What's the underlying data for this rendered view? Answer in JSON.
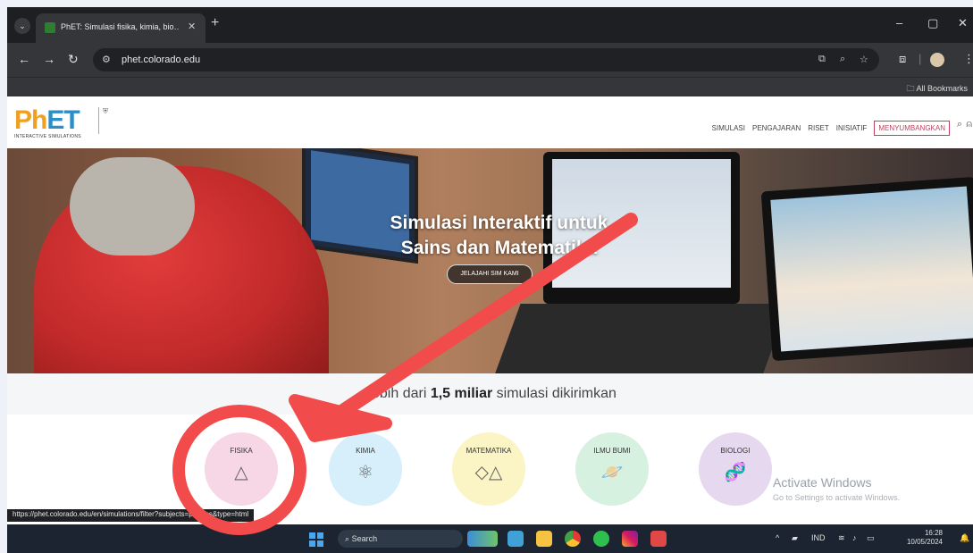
{
  "browser": {
    "tab_title": "PhET: Simulasi fisika, kimia, bio…",
    "tab_close": "✕",
    "new_tab": "+",
    "url": "phet.colorado.edu",
    "bookmarks_label": "All Bookmarks",
    "window_controls": [
      "–",
      "▢",
      "✕"
    ]
  },
  "site": {
    "logo_main_ph": "Ph",
    "logo_main_et": "ET",
    "logo_sub": "INTERACTIVE SIMULATIONS",
    "nav": [
      "SIMULASI",
      "PENGAJARAN",
      "RISET",
      "INISIATIF"
    ],
    "donate": "MENYUMBANGKAN"
  },
  "hero": {
    "title_line1": "Simulasi Interaktif untuk",
    "title_line2": "Sains dan Matematika",
    "button": "JELAJAHI SIM KAMI"
  },
  "stats": {
    "prefix": "Lebih dari",
    "highlight": "1,5 miliar",
    "suffix": "simulasi dikirimkan"
  },
  "subjects": [
    {
      "label": "FISIKA",
      "color": "#f7d7e6",
      "icon": "prism-icon",
      "glyph": "△"
    },
    {
      "label": "KIMIA",
      "color": "#d6effa",
      "icon": "molecule-icon",
      "glyph": "⚛"
    },
    {
      "label": "MATEMATIKA",
      "color": "#fbf4c5",
      "icon": "shapes-icon",
      "glyph": "◇△"
    },
    {
      "label": "ILMU BUMI",
      "color": "#d6f1df",
      "icon": "planet-icon",
      "glyph": "🪐"
    },
    {
      "label": "BIOLOGI",
      "color": "#e6d8ef",
      "icon": "dna-icon",
      "glyph": "🧬"
    }
  ],
  "windows_watermark": {
    "title": "Activate Windows",
    "subtitle": "Go to Settings to activate Windows."
  },
  "status_url": "https://phet.colorado.edu/en/simulations/filter?subjects=physics&type=html",
  "taskbar": {
    "search": "Search",
    "lang": "IND",
    "time": "16:28",
    "date": "10/05/2024"
  },
  "annotation": {
    "color": "#f24b4b"
  }
}
